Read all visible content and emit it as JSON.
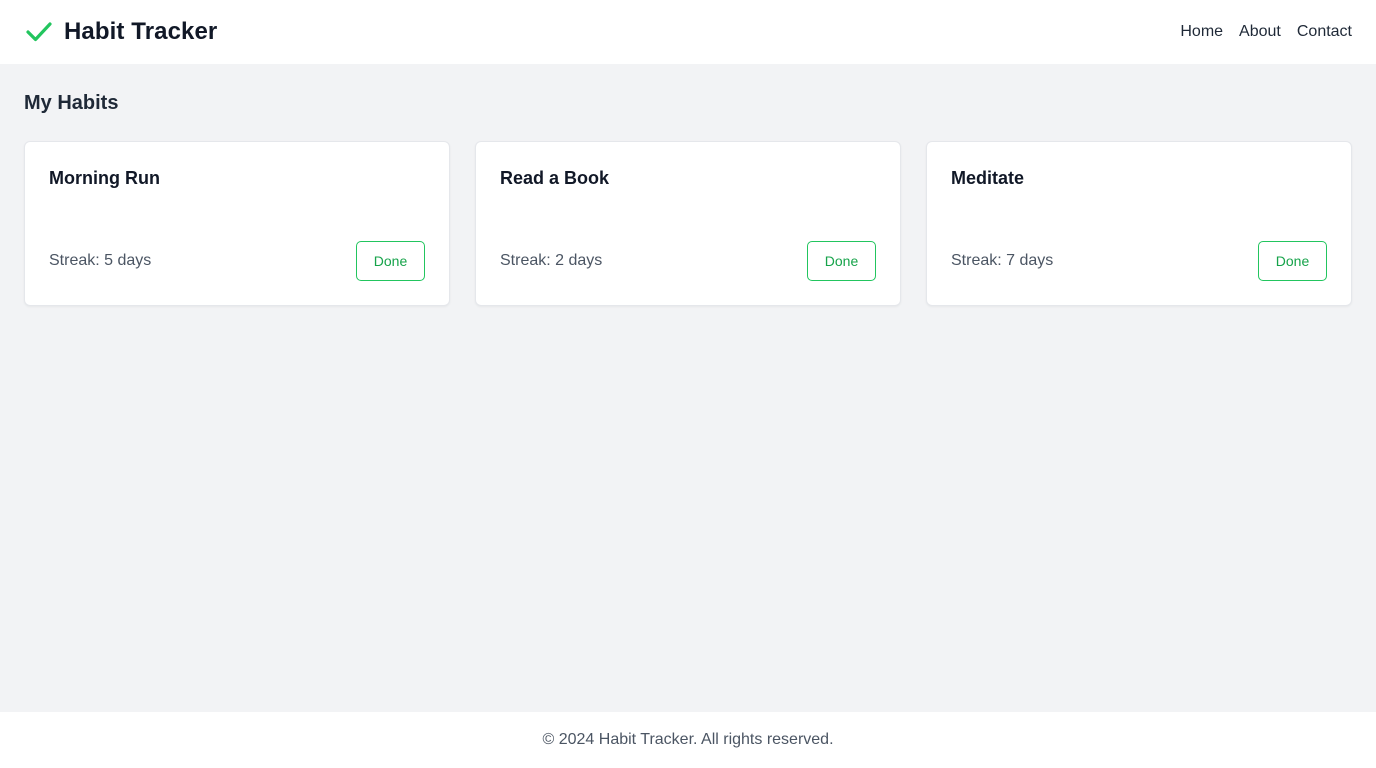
{
  "header": {
    "brand_icon": "check-icon",
    "title": "Habit Tracker",
    "nav": [
      {
        "label": "Home"
      },
      {
        "label": "About"
      },
      {
        "label": "Contact"
      }
    ]
  },
  "main": {
    "title": "My Habits",
    "habits": [
      {
        "name": "Morning Run",
        "streak": "Streak: 5 days",
        "button": "Done"
      },
      {
        "name": "Read a Book",
        "streak": "Streak: 2 days",
        "button": "Done"
      },
      {
        "name": "Meditate",
        "streak": "Streak: 7 days",
        "button": "Done"
      }
    ]
  },
  "footer": {
    "text": "© 2024 Habit Tracker. All rights reserved."
  },
  "colors": {
    "accent": "#22c55e",
    "background": "#f2f3f5",
    "surface": "#ffffff",
    "text": "#111827",
    "muted_text": "#4b5563"
  }
}
